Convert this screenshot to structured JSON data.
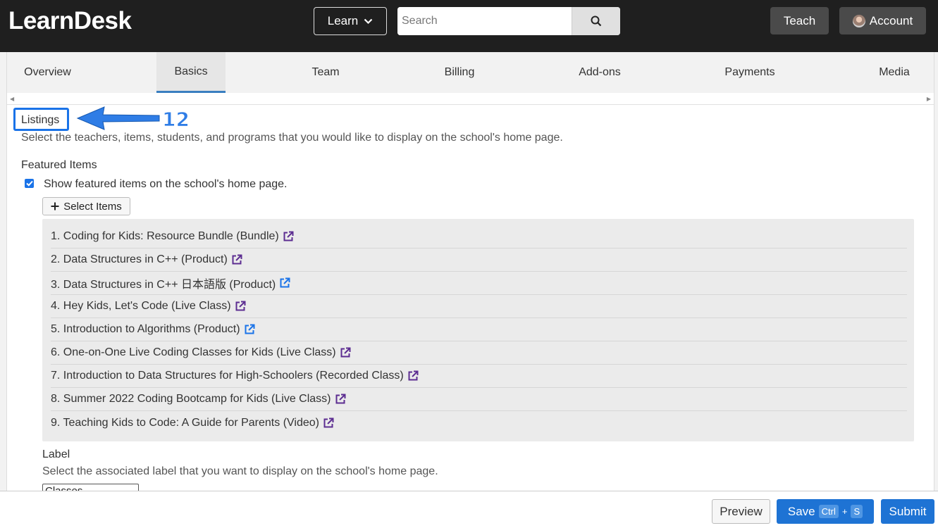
{
  "header": {
    "logo": "LearnDesk",
    "learn_label": "Learn",
    "search_placeholder": "Search",
    "teach_label": "Teach",
    "account_label": "Account"
  },
  "tabs": [
    "Overview",
    "Basics",
    "Team",
    "Billing",
    "Add-ons",
    "Payments",
    "Media"
  ],
  "active_tab": "Basics",
  "annotation": {
    "number": "12"
  },
  "listings": {
    "title": "Listings",
    "description": "Select the teachers, items, students, and programs that you would like to display on the school's home page.",
    "featured_heading": "Featured Items",
    "featured_checkbox_label": "Show featured items on the school's home page.",
    "featured_checked": true,
    "select_items_label": "Select Items",
    "items": [
      "1. Coding for Kids: Resource Bundle (Bundle)",
      "2. Data Structures in C++ (Product)",
      "3. Data Structures in C++ 日本語版 (Product)",
      "4. Hey Kids, Let's Code (Live Class)",
      "5. Introduction to Algorithms (Product)",
      "6. One-on-One Live Coding Classes for Kids (Live Class)",
      "7. Introduction to Data Structures for High-Schoolers (Recorded Class)",
      "8. Summer 2022 Coding Bootcamp for Kids (Live Class)",
      "9. Teaching Kids to Code: A Guide for Parents (Video)"
    ],
    "label_heading": "Label",
    "label_description": "Select the associated label that you want to display on the school's home page.",
    "label_selected": "Classes"
  },
  "footer": {
    "preview_label": "Preview",
    "save_label": "Save",
    "save_kbd_ctrl": "Ctrl",
    "save_kbd_plus": "+",
    "save_kbd_key": "S",
    "submit_label": "Submit"
  },
  "colors": {
    "accent": "#1e73d4",
    "annotation_blue": "#1a73e8",
    "link_purple": "#5c2d91",
    "link_blue": "#1a73e8"
  },
  "icons": [
    "chevron-down-icon",
    "search-icon",
    "plus-icon",
    "external-link-icon",
    "checkmark-icon"
  ]
}
